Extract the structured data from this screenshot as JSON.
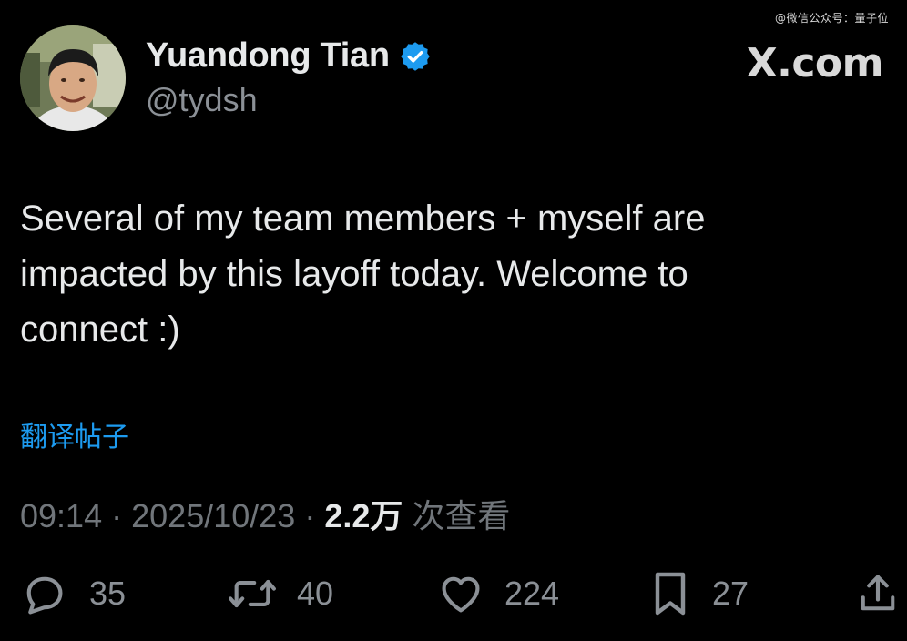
{
  "watermark": "@微信公众号：量子位",
  "author": {
    "display_name": "Yuandong Tian",
    "handle": "@tydsh",
    "verified": true
  },
  "brand": "X.com",
  "tweet": {
    "text_lines": [
      "Several of my team members + myself are",
      "impacted by this layoff today. Welcome to",
      "connect :)"
    ],
    "translate_link": "翻译帖子"
  },
  "meta": {
    "time": "09:14",
    "date": "2025/10/23",
    "separator": "·",
    "views_count": "2.2",
    "views_unit": "万",
    "views_label": "次查看"
  },
  "actions": {
    "replies": "35",
    "reposts": "40",
    "likes": "224",
    "bookmarks": "27"
  },
  "colors": {
    "background": "#000000",
    "text_primary": "#e7e9ea",
    "text_secondary": "#71767b",
    "link": "#1d9bf0",
    "verified": "#1d9bf0"
  },
  "icons": {
    "verified": "verified-badge-icon",
    "reply": "reply-icon",
    "repost": "repost-icon",
    "like": "heart-icon",
    "bookmark": "bookmark-icon",
    "share": "share-icon"
  }
}
